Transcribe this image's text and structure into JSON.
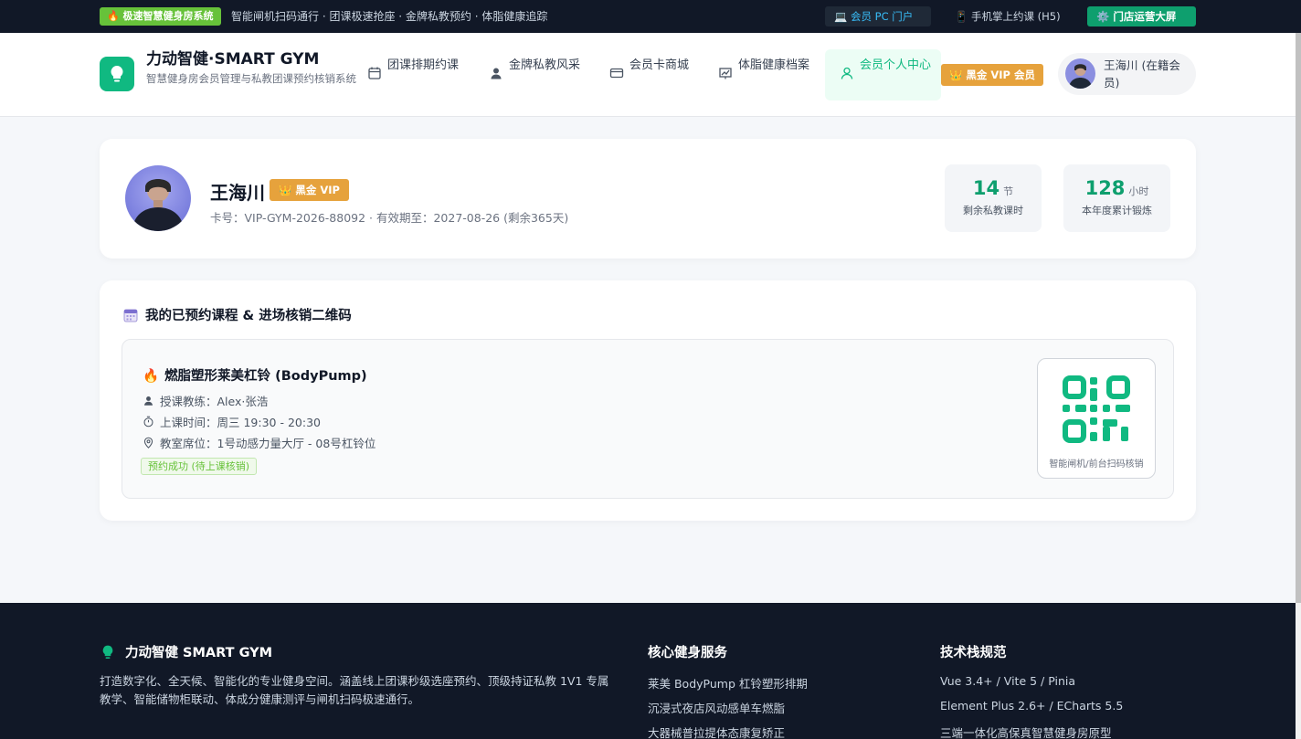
{
  "topbar": {
    "badge": "🔥 极速智慧健身房系统",
    "slogan": "智能闸机扫码通行 · 团课极速抢座 · 金牌私教预约 · 体脂健康追踪",
    "pc_portal": "💻 会员 PC 门户",
    "h5": "📱 手机掌上约课 (H5)",
    "screen": "⚙️ 门店运营大屏"
  },
  "header": {
    "brand_title": "力动智健·SMART GYM",
    "brand_sub": "智慧健身房会员管理与私教团课预约核销系统",
    "nav": [
      {
        "label": "团课排期约课",
        "icon": "calendar-icon"
      },
      {
        "label": "金牌私教风采",
        "icon": "user-icon"
      },
      {
        "label": "会员卡商城",
        "icon": "credit-card-icon"
      },
      {
        "label": "体脂健康档案",
        "icon": "chart-icon"
      },
      {
        "label": "会员个人中心",
        "icon": "user-outline-icon"
      }
    ],
    "vip": "👑 黑金 VIP 会员",
    "user": "王海川 (在籍会员)"
  },
  "profile": {
    "name": "王海川",
    "vip": "👑 黑金 VIP",
    "card_info": "卡号：VIP-GYM-2026-88092 · 有效期至：2027-08-26 (剩余365天)",
    "stats": [
      {
        "value": "14",
        "unit": "节",
        "label": "剩余私教课时"
      },
      {
        "value": "128",
        "unit": "小时",
        "label": "本年度累计锻炼"
      }
    ]
  },
  "bookings": {
    "title": "我的已预约课程 & 进场核销二维码",
    "course": {
      "title": "燃脂塑形莱美杠铃 (BodyPump)",
      "coach": "授课教练：Alex·张浩",
      "time": "上课时间：周三 19:30 - 20:30",
      "seat": "教室席位：1号动感力量大厅 - 08号杠铃位",
      "status": "预约成功 (待上课核销)",
      "qr_label": "智能闸机/前台扫码核销"
    }
  },
  "footer": {
    "brand": "力动智健 SMART GYM",
    "desc": "打造数字化、全天候、智能化的专业健身空间。涵盖线上团课秒级选座预约、顶级持证私教 1V1 专属教学、智能储物柜联动、体成分健康测评与闸机扫码极速通行。",
    "services_title": "核心健身服务",
    "services": [
      "莱美 BodyPump 杠铃塑形排期",
      "沉浸式夜店风动感单车燃脂",
      "大器械普拉提体态康复矫正"
    ],
    "tech_title": "技术栈规范",
    "tech": [
      "Vue 3.4+ / Vite 5 / Pinia",
      "Element Plus 2.6+ / ECharts 5.5",
      "三端一体化高保真智慧健身房原型"
    ]
  },
  "colors": {
    "accent": "#10b981",
    "gold": "#e6a23c",
    "dark": "#111827"
  }
}
